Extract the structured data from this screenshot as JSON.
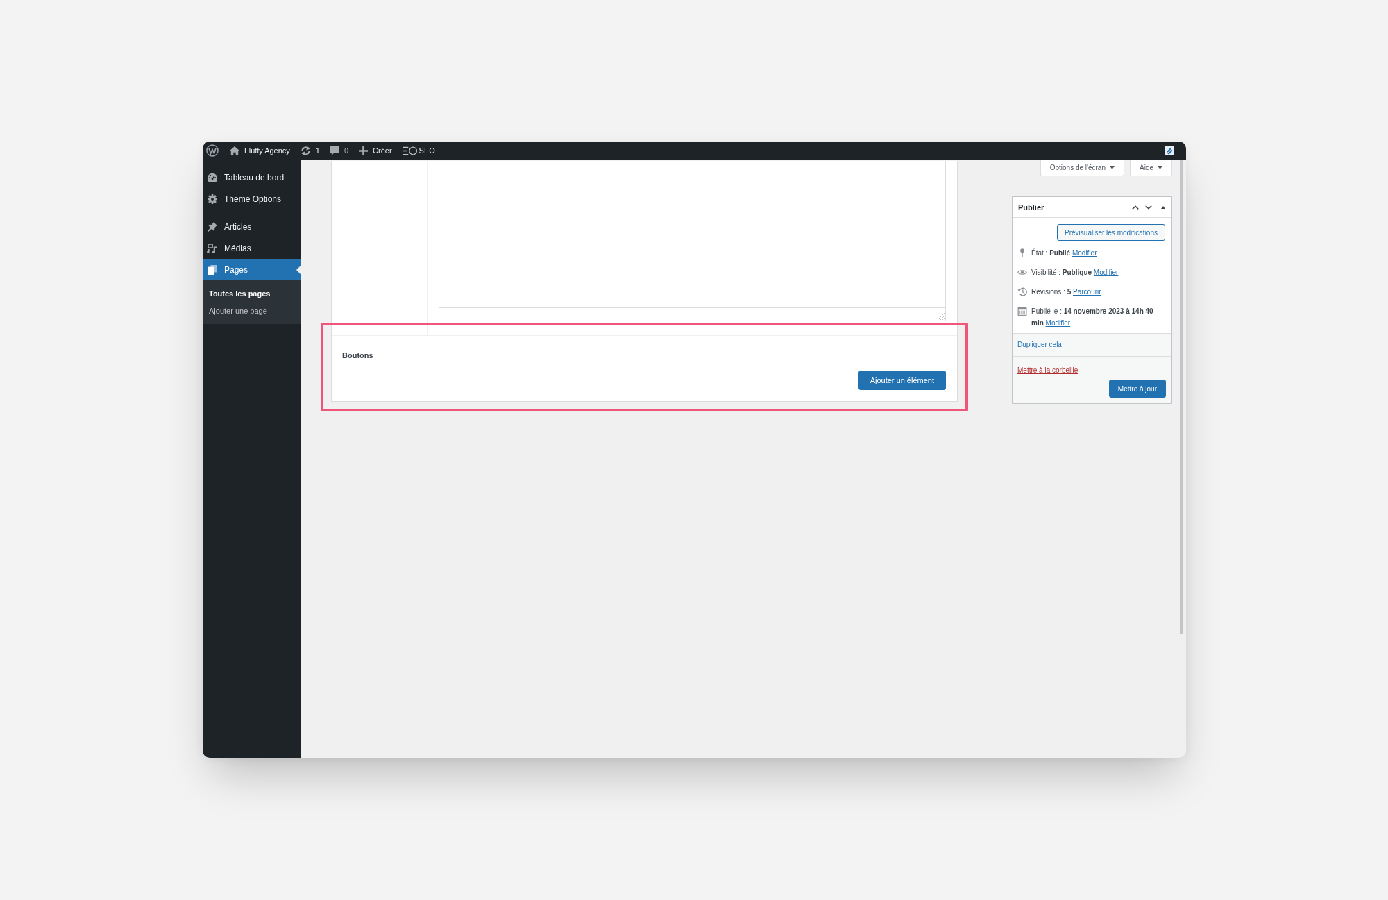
{
  "admin_bar": {
    "items": [
      {
        "kind": "site",
        "label": "Fluffy Agency"
      },
      {
        "kind": "updates",
        "label": "1"
      },
      {
        "kind": "comments",
        "label": "0"
      },
      {
        "kind": "new",
        "label": "Créer"
      },
      {
        "kind": "seo",
        "label": "SEO"
      }
    ]
  },
  "sidebar": {
    "groups": [
      {
        "items": [
          {
            "kind": "dashboard",
            "label": "Tableau de bord",
            "selected": false
          },
          {
            "kind": "settings",
            "label": "Theme Options",
            "selected": false
          }
        ]
      },
      {
        "items": [
          {
            "kind": "posts",
            "label": "Articles",
            "selected": false
          },
          {
            "kind": "media",
            "label": "Médias",
            "selected": false
          },
          {
            "kind": "pages",
            "label": "Pages",
            "selected": true,
            "children": [
              {
                "label": "Toutes les pages",
                "selected": true
              },
              {
                "label": "Ajouter une page",
                "selected": false
              }
            ]
          }
        ]
      }
    ]
  },
  "screen_tabs": [
    {
      "label": "Options de l'écran"
    },
    {
      "label": "Aide"
    }
  ],
  "content_box": {
    "fields": [
      {
        "kind": "textarea"
      },
      {
        "kind": "repeater",
        "label": "Boutons",
        "button": "Ajouter un élément",
        "highlighted": true
      }
    ]
  },
  "publish_box": {
    "title": "Publier",
    "preview_button": "Prévisualiser les modifications",
    "rows": [
      {
        "kind": "status",
        "text": "État : **Publié**",
        "link": "Modifier"
      },
      {
        "kind": "visibility",
        "text": "Visibilité : **Publique**",
        "link": "Modifier"
      },
      {
        "kind": "revisions",
        "text": "Révisions : **5**",
        "link": "Parcourir"
      },
      {
        "kind": "date",
        "text": "Publié le : **14 novembre 2023 à 14h 40 min**",
        "link": "Modifier"
      }
    ],
    "duplicate_link": "Dupliquer cela",
    "trash_link": "Mettre à la corbeille",
    "update_button": "Mettre à jour"
  }
}
